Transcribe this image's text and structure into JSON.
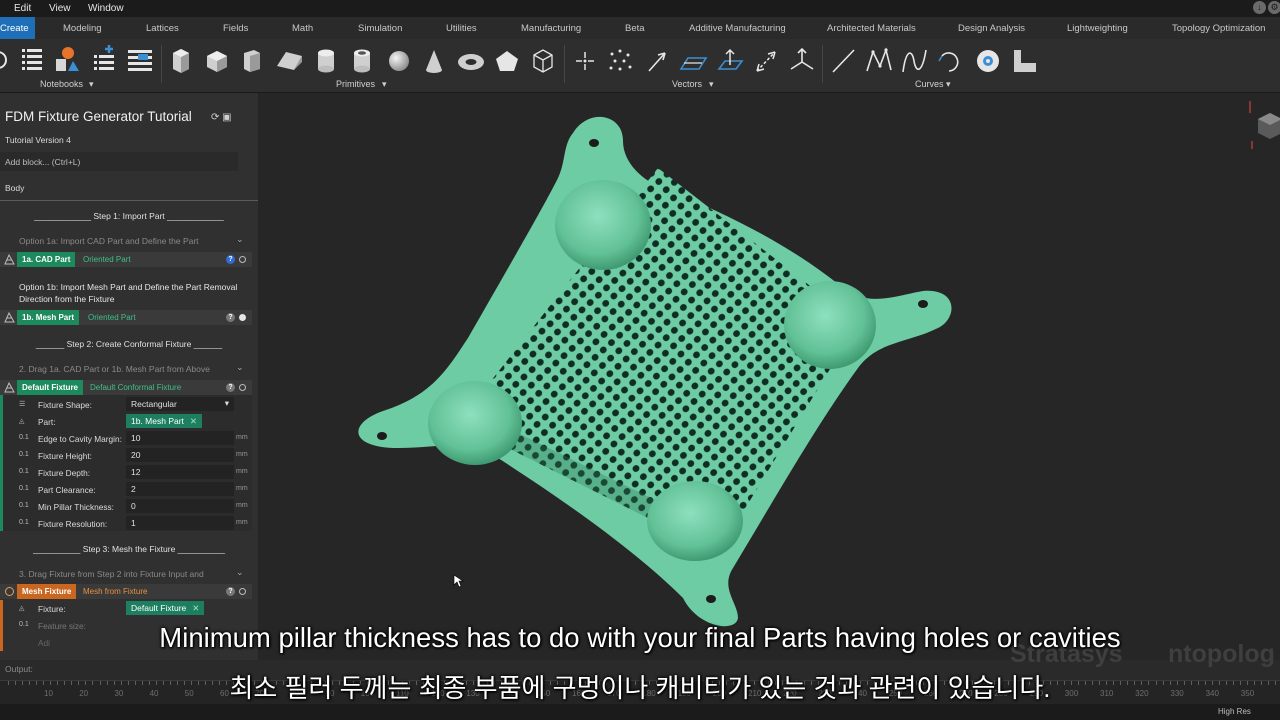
{
  "menu": {
    "items": [
      "Edit",
      "View",
      "Window"
    ]
  },
  "tabs": [
    {
      "label": "Create",
      "active": true
    },
    {
      "label": "Modeling"
    },
    {
      "label": "Lattices"
    },
    {
      "label": "Fields"
    },
    {
      "label": "Math"
    },
    {
      "label": "Simulation"
    },
    {
      "label": "Utilities"
    },
    {
      "label": "Manufacturing"
    },
    {
      "label": "Beta"
    },
    {
      "label": "Additive Manufacturing"
    },
    {
      "label": "Architected Materials"
    },
    {
      "label": "Design Analysis"
    },
    {
      "label": "Lightweighting"
    },
    {
      "label": "Topology Optimization"
    }
  ],
  "toolbar": {
    "groups": [
      {
        "label": "Notebooks",
        "icons": [
          "notebook-sync-icon",
          "list-icon",
          "shapes-icon",
          "add-list-icon",
          "align-list-icon"
        ]
      },
      {
        "label": "Primitives",
        "icons": [
          "cube-icon",
          "box-icon",
          "prism-icon",
          "wedge-icon",
          "cylinder-icon",
          "tube-icon",
          "sphere-icon",
          "cone-icon",
          "torus-icon",
          "pentagon-icon",
          "wireframe-cube-icon"
        ]
      },
      {
        "label": "Vectors",
        "icons": [
          "point-icon",
          "point-cloud-icon",
          "vector-icon",
          "plane-icon",
          "plane-normal-icon",
          "line-segment-icon",
          "frame-icon"
        ]
      },
      {
        "label": "Curves",
        "icons": [
          "line-icon",
          "polyline-icon",
          "spline-icon",
          "arc-icon",
          "circle-icon",
          "profile-icon"
        ]
      }
    ]
  },
  "sidebar": {
    "title": "FDM Fixture Generator Tutorial",
    "version": "Tutorial Version 4",
    "add_block": "Add block... (Ctrl+L)",
    "body_label": "Body",
    "step1": "____________ Step 1: Import Part ____________",
    "option1a": "Option 1a: Import CAD Part and Define the Part",
    "cad_part": {
      "tag": "1a. CAD Part",
      "sub": "Oriented Part"
    },
    "option1b": "Option 1b: Import Mesh Part and Define the Part Removal Direction from the Fixture",
    "mesh_part": {
      "tag": "1b. Mesh Part",
      "sub": "Oriented Part"
    },
    "step2": "______ Step 2: Create Conformal Fixture ______",
    "drag2": "2. Drag 1a. CAD Part or 1b. Mesh Part from Above",
    "default_fixture": {
      "tag": "Default Fixture",
      "sub": "Default Conformal Fixture"
    },
    "params": [
      {
        "label": "Fixture Shape:",
        "value": "Rectangular",
        "unit": "",
        "kind": "select",
        "icon": "list"
      },
      {
        "label": "Part:",
        "value": "1b. Mesh Part",
        "unit": "",
        "kind": "chip",
        "icon": "mesh"
      },
      {
        "label": "Edge to Cavity Margin:",
        "value": "10",
        "unit": "mm",
        "kind": "num",
        "icon": "0.1"
      },
      {
        "label": "Fixture Height:",
        "value": "20",
        "unit": "mm",
        "kind": "num",
        "icon": "0.1"
      },
      {
        "label": "Fixture Depth:",
        "value": "12",
        "unit": "mm",
        "kind": "num",
        "icon": "0.1"
      },
      {
        "label": "Part Clearance:",
        "value": "2",
        "unit": "mm",
        "kind": "num",
        "icon": "0.1"
      },
      {
        "label": "Min Pillar Thickness:",
        "value": "0",
        "unit": "mm",
        "kind": "num",
        "icon": "0.1"
      },
      {
        "label": "Fixture Resolution:",
        "value": "1",
        "unit": "mm",
        "kind": "num",
        "icon": "0.1"
      }
    ],
    "step3": "__________ Step 3: Mesh the Fixture __________",
    "drag3": "3. Drag Fixture from Step 2 into Fixture Input and",
    "mesh_fixture": {
      "tag": "Mesh Fixture",
      "sub": "Mesh from Fixture"
    },
    "mesh_params": [
      {
        "label": "Fixture:",
        "value": "Default Fixture"
      },
      {
        "label": "Feature size:",
        "value": ""
      },
      {
        "label": "Adi",
        "value": ""
      }
    ]
  },
  "colors": {
    "accent_green": "#1d8a5e",
    "part_green": "#6dcca4",
    "orange": "#c9661f",
    "tab_blue": "#1f6fb8"
  },
  "output_label": "Output:",
  "ruler_numbers": [
    "10",
    "20",
    "30",
    "40",
    "50",
    "60",
    "70",
    "80",
    "90",
    "100",
    "110",
    "120",
    "130",
    "140",
    "150",
    "160",
    "170",
    "180",
    "190",
    "200",
    "210",
    "220",
    "230",
    "240",
    "250",
    "260",
    "270",
    "280",
    "290",
    "300",
    "310",
    "320",
    "330",
    "340",
    "350"
  ],
  "status": {
    "render_mode": "High Res"
  },
  "watermark": {
    "stratasys": "Stratasys",
    "ntopology": "ntopolog"
  },
  "subtitles": {
    "en": "Minimum pillar thickness has to do with your final Parts having holes or cavities",
    "ko": "최소 필러 두께는 최종 부품에 구멍이나 캐비티가 있는 것과 관련이 있습니다."
  }
}
